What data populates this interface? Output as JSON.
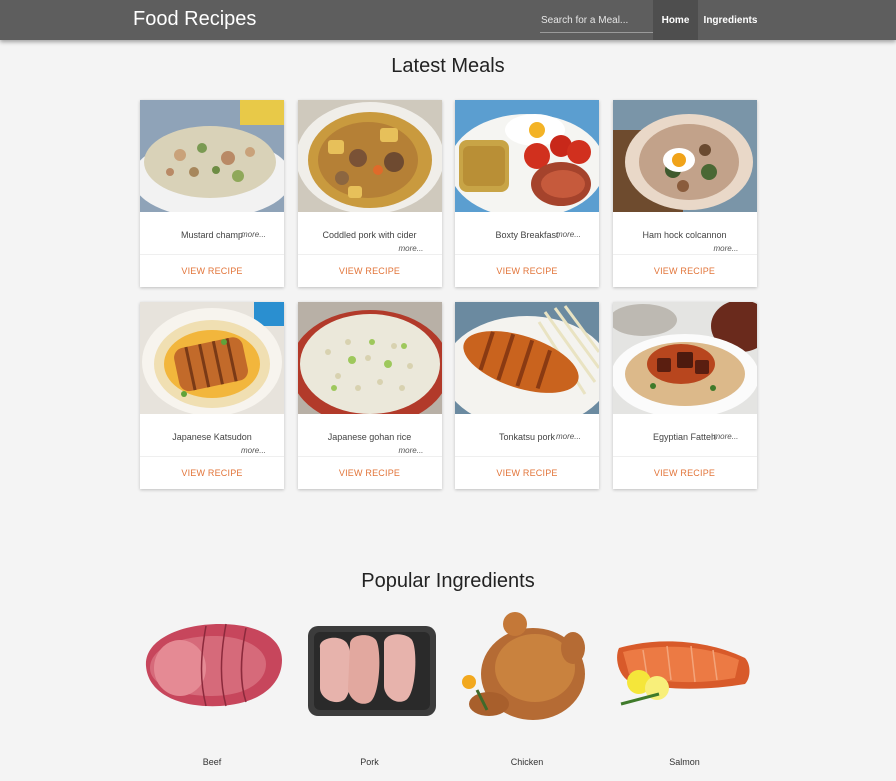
{
  "app": {
    "brand": "Food Recipes"
  },
  "nav": {
    "search_placeholder": "Search for a Meal...",
    "home_label": "Home",
    "ingredients_label": "Ingredients"
  },
  "latest": {
    "title": "Latest Meals",
    "action_label": "VIEW RECIPE",
    "more_label": "more...",
    "meals": [
      {
        "name": "Mustard champ"
      },
      {
        "name": "Coddled pork with cider"
      },
      {
        "name": "Boxty Breakfast"
      },
      {
        "name": "Ham hock colcannon"
      },
      {
        "name": "Japanese Katsudon"
      },
      {
        "name": "Japanese gohan rice"
      },
      {
        "name": "Tonkatsu pork"
      },
      {
        "name": "Egyptian Fatteh"
      }
    ]
  },
  "popular": {
    "title": "Popular Ingredients",
    "items": [
      {
        "name": "Beef"
      },
      {
        "name": "Pork"
      },
      {
        "name": "Chicken"
      },
      {
        "name": "Salmon"
      }
    ]
  },
  "colors": {
    "navbar": "#5e5e5e",
    "nav_active": "#4e4e4e",
    "accent": "#e2753a",
    "background": "#f4f4f4"
  }
}
